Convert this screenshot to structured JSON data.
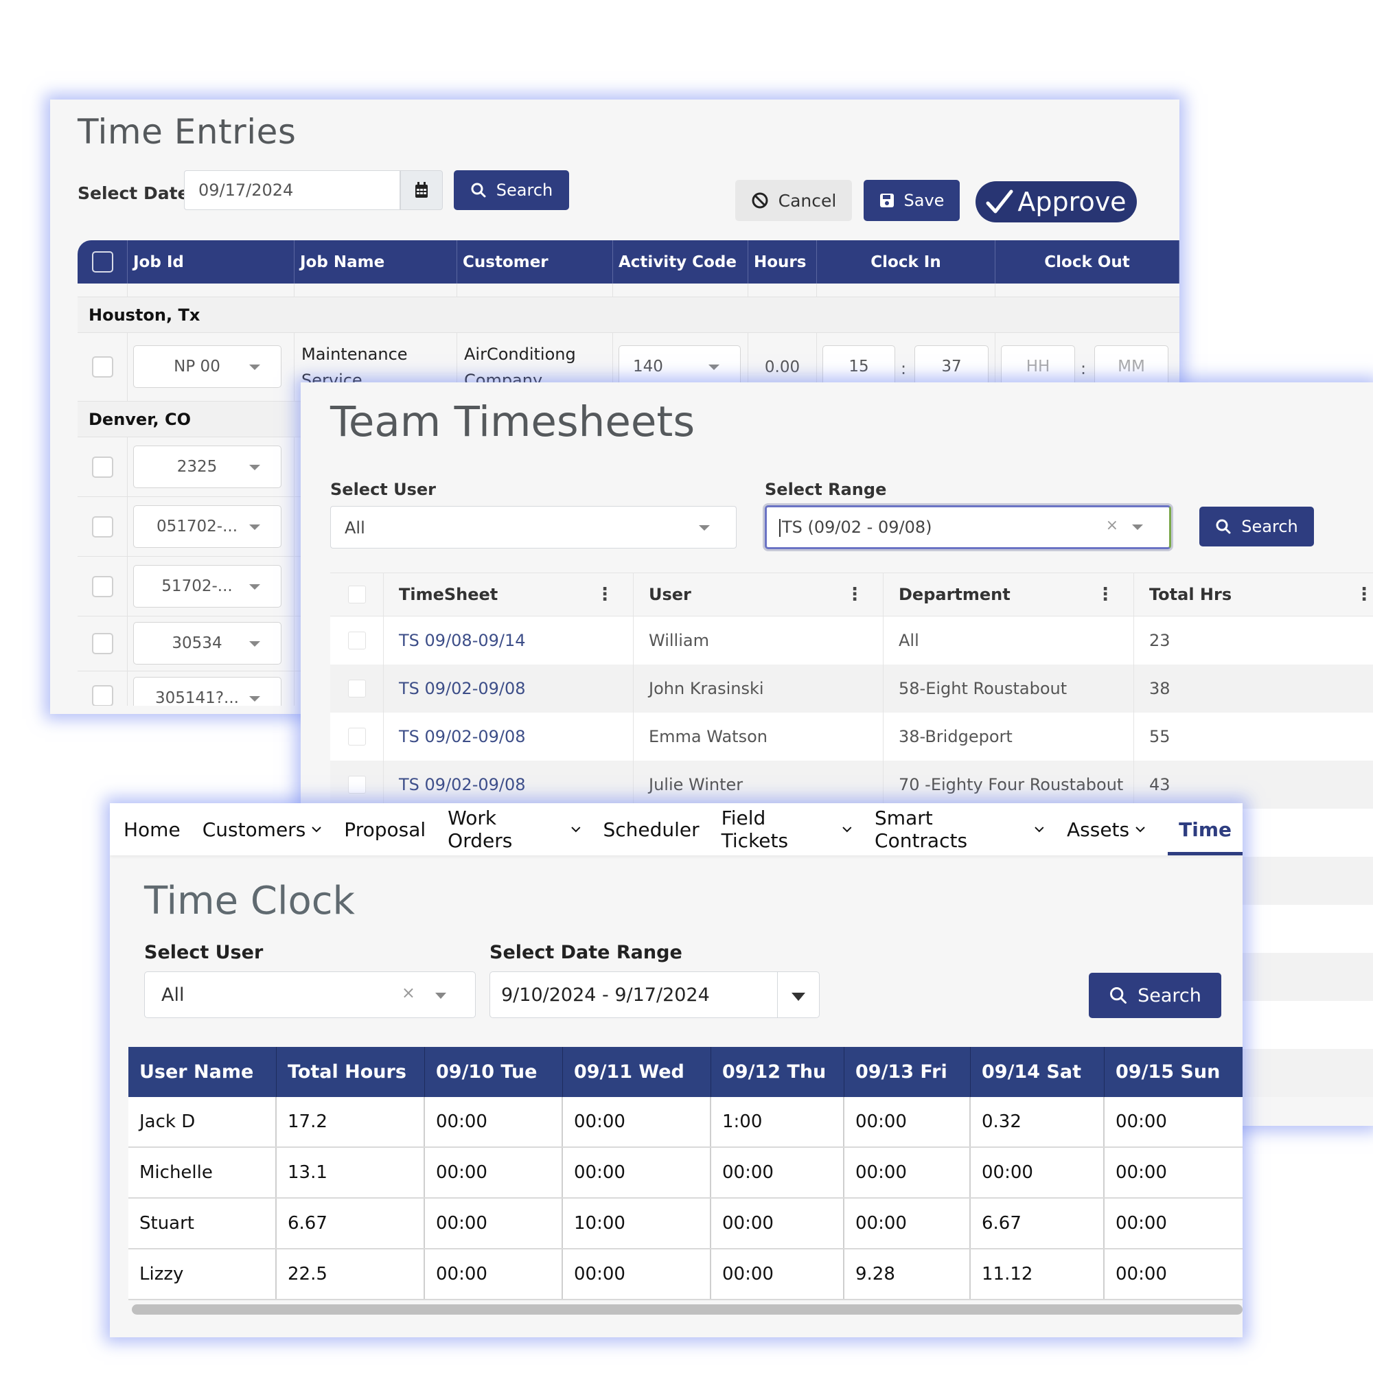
{
  "time_entries": {
    "title": "Time Entries",
    "select_date_label": "Select Date",
    "date_value": "09/17/2024",
    "search_label": "Search",
    "cancel_label": "Cancel",
    "save_label": "Save",
    "approve_label": "Approve",
    "columns": [
      "Job Id",
      "Job Name",
      "Customer",
      "Activity Code",
      "Hours",
      "Clock In",
      "Clock Out"
    ],
    "groups": [
      {
        "name": "Houston, Tx",
        "rows": [
          {
            "job_id": "NP 00",
            "job_name": "Maintenance Service",
            "customer": "AirConditiong Company",
            "activity_code": "140",
            "hours": "0.00",
            "clock_in_hh": "15",
            "clock_in_mm": "37",
            "clock_out_hh_placeholder": "HH",
            "clock_out_mm_placeholder": "MM"
          }
        ]
      },
      {
        "name": "Denver, CO",
        "rows": [
          {
            "job_id": "2325"
          },
          {
            "job_id": "051702-..."
          },
          {
            "job_id": "51702-..."
          },
          {
            "job_id": "30534"
          },
          {
            "job_id": "305141?..."
          }
        ]
      }
    ]
  },
  "team_timesheets": {
    "title": "Team Timesheets",
    "select_user_label": "Select User",
    "select_user_value": "All",
    "select_range_label": "Select Range",
    "select_range_value": "TS (09/02 - 09/08)",
    "search_label": "Search",
    "columns": [
      "TimeSheet",
      "User",
      "Department",
      "Total Hrs"
    ],
    "rows": [
      {
        "timesheet": "TS 09/08-09/14",
        "user": "William",
        "department": "All",
        "total_hrs": "23"
      },
      {
        "timesheet": "TS 09/02-09/08",
        "user": "John Krasinski",
        "department": "58-Eight Roustabout",
        "total_hrs": "38"
      },
      {
        "timesheet": "TS 09/02-09/08",
        "user": "Emma Watson",
        "department": "38-Bridgeport",
        "total_hrs": "55"
      },
      {
        "timesheet": "TS 09/02-09/08",
        "user": "Julie Winter",
        "department": "70 -Eighty Four Roustabout",
        "total_hrs": "43"
      }
    ]
  },
  "time_clock": {
    "nav": [
      {
        "label": "Home",
        "dropdown": false
      },
      {
        "label": "Customers",
        "dropdown": true
      },
      {
        "label": "Proposal",
        "dropdown": false
      },
      {
        "label": "Work Orders",
        "dropdown": true
      },
      {
        "label": "Scheduler",
        "dropdown": false
      },
      {
        "label": "Field Tickets",
        "dropdown": true
      },
      {
        "label": "Smart Contracts",
        "dropdown": true
      },
      {
        "label": "Assets",
        "dropdown": true
      },
      {
        "label": "Time",
        "dropdown": false,
        "active": true
      }
    ],
    "title": "Time Clock",
    "select_user_label": "Select User",
    "select_user_value": "All",
    "select_date_range_label": "Select Date Range",
    "date_range_value": "9/10/2024 - 9/17/2024",
    "search_label": "Search",
    "columns": [
      "User Name",
      "Total Hours",
      "09/10 Tue",
      "09/11 Wed",
      "09/12 Thu",
      "09/13 Fri",
      "09/14 Sat",
      "09/15 Sun"
    ],
    "rows": [
      {
        "user": "Jack D",
        "total": "17.2",
        "days": [
          "00:00",
          "00:00",
          "1:00",
          "00:00",
          "0.32",
          "00:00"
        ]
      },
      {
        "user": "Michelle",
        "total": "13.1",
        "days": [
          "00:00",
          "00:00",
          "00:00",
          "00:00",
          "00:00",
          "00:00"
        ]
      },
      {
        "user": "Stuart",
        "total": "6.67",
        "days": [
          "00:00",
          "10:00",
          "00:00",
          "00:00",
          "6.67",
          "00:00"
        ]
      },
      {
        "user": "Lizzy",
        "total": "22.5",
        "days": [
          "00:00",
          "00:00",
          "00:00",
          "9.28",
          "11.12",
          "00:00"
        ]
      }
    ]
  },
  "colors": {
    "primary": "#2e3d80",
    "header_blue": "#2d4180",
    "link": "#3d4e88",
    "panel_glow": "#7c8cf0"
  }
}
